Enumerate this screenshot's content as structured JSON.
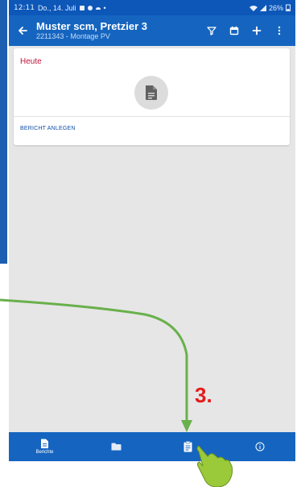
{
  "status_bar": {
    "time": "12:11",
    "date": "Do., 14. Juli",
    "battery": "26%"
  },
  "app_bar": {
    "title": "Muster scm, Pretzier 3",
    "subtitle": "2211343 - Montage PV",
    "back_icon": "arrow-left-icon",
    "actions": [
      "filter-icon",
      "calendar-icon",
      "plus-icon",
      "more-vert-icon"
    ]
  },
  "card": {
    "day_label": "Heute",
    "create_label": "BERICHT ANLEGEN"
  },
  "bottom_nav": {
    "tabs": [
      {
        "label": "Berichte",
        "icon": "document-icon"
      },
      {
        "label": "",
        "icon": "folder-icon"
      },
      {
        "label": "",
        "icon": "clipboard-icon"
      },
      {
        "label": "",
        "icon": "info-icon"
      }
    ]
  },
  "annotation": {
    "step": "3.",
    "arrow_color": "#6ab04c",
    "step_color": "#e41b1b"
  },
  "colors": {
    "app_bar": "#1565c0",
    "status_bar": "#0c57b8",
    "day_label": "#c0143c",
    "link": "#0d4fa8"
  }
}
